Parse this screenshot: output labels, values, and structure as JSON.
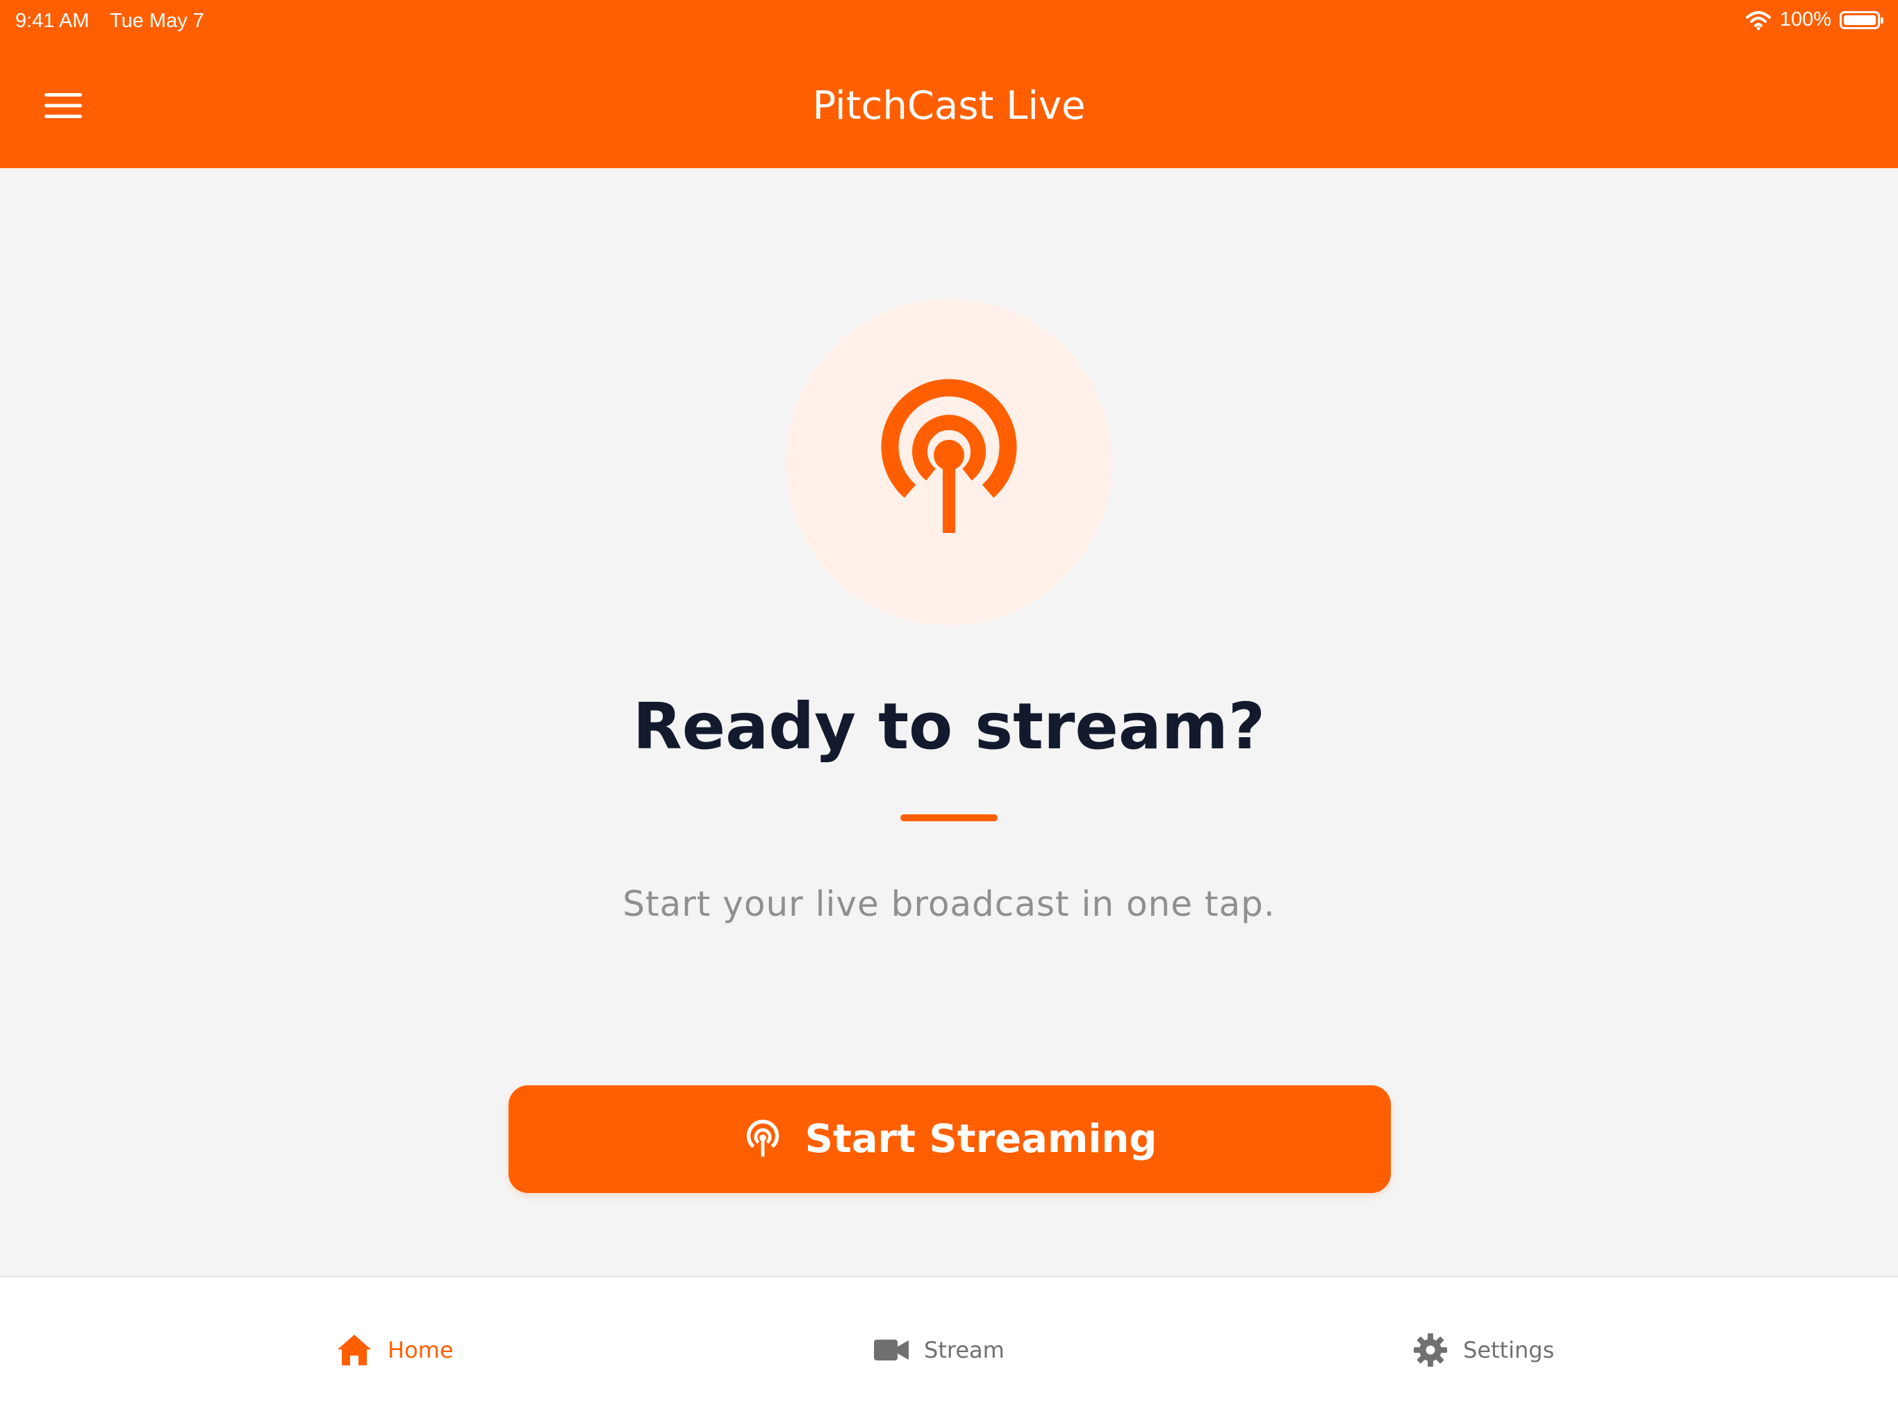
{
  "status_bar": {
    "time": "9:41 AM",
    "date": "Tue May 7",
    "battery": "100%"
  },
  "header": {
    "title": "PitchCast Live",
    "menu_icon": "hamburger-menu-icon"
  },
  "main": {
    "hero_icon": "broadcast-icon",
    "headline": "Ready to stream?",
    "subtitle": "Start your live broadcast in one tap.",
    "cta": {
      "label": "Start Streaming",
      "icon": "broadcast-icon"
    }
  },
  "tabs": [
    {
      "label": "Home",
      "icon": "home-icon",
      "active": true
    },
    {
      "label": "Stream",
      "icon": "video-camera-icon",
      "active": false
    },
    {
      "label": "Settings",
      "icon": "gear-icon",
      "active": false
    }
  ],
  "colors": {
    "accent": "#ff5f00",
    "background": "#f4f4f4",
    "headline": "#131a2e",
    "subtitle": "#8f8f8f",
    "hero_circle": "#fff0ea",
    "tab_inactive": "#707070"
  }
}
